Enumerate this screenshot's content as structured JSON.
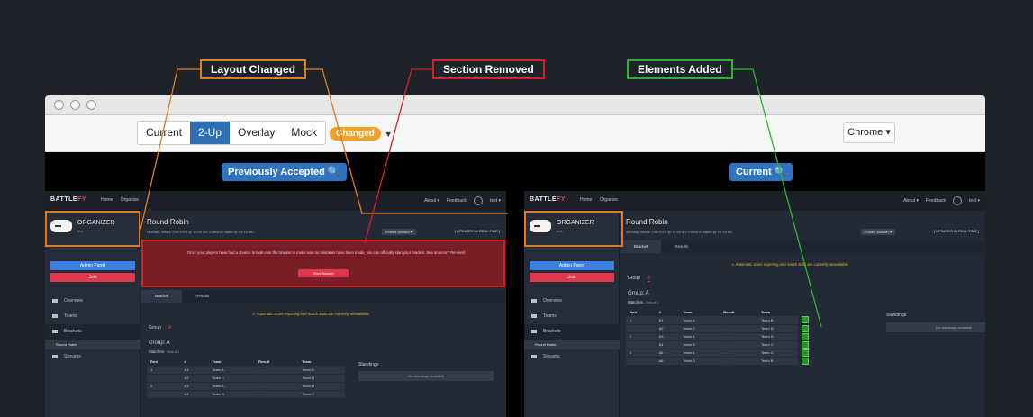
{
  "callouts": {
    "layout": "Layout Changed",
    "removed": "Section Removed",
    "added": "Elements Added"
  },
  "toolbar": {
    "modes": [
      "Current",
      "2-Up",
      "Overlay",
      "Mock"
    ],
    "active_mode": "2-Up",
    "status_badge": "Changed",
    "browser": "Chrome ▾"
  },
  "panes": {
    "left_label": "Previously Accepted 🔍",
    "right_label": "Current 🔍"
  },
  "app": {
    "logo_a": "BATTLE",
    "logo_b": "FY",
    "nav": [
      "Home",
      "Organize"
    ],
    "nav_right": [
      "About ▾",
      "Feedback",
      "test ▾"
    ],
    "org_name": "ORGANIZER",
    "org_sub": "test",
    "admin_btn": "Admin Panel",
    "join_btn": "Join",
    "menu": [
      "Overview",
      "Teams",
      "Brackets",
      "Streams"
    ],
    "menu_sub": "Round Robin",
    "title": "Round Robin",
    "meta": "Monday, March 2nd 2015 @ 11:00 am    Check-in starts @ 10:45 am",
    "embed": "Embed Bracket ▾",
    "realtime": "[ UPDATES IN REAL TIME ]",
    "alert_text": "Once your players have had a chance to look over the bracket to make sure no mistakes have been made, you can officially start your bracket. See an error? Re-seed",
    "alert_btn": "Start Bracket",
    "tabs": [
      "Bracket",
      "Results"
    ],
    "warning": "⚠ Automatic score reporting and match stats are currently unavailable",
    "group_label": "Group",
    "group_value": "A",
    "group_heading": "Group: A",
    "matches": "Matches",
    "matches_sub": "- Best of 1",
    "columns": [
      "Rnd",
      "#",
      "Team",
      "Result",
      "Team"
    ],
    "rows": [
      {
        "rnd": "1",
        "num": "A1",
        "t1": "Team A",
        "res": "- : -",
        "t2": "Team B"
      },
      {
        "rnd": "",
        "num": "A2",
        "t1": "Team C",
        "res": "- : -",
        "t2": "Team D"
      },
      {
        "rnd": "2",
        "num": "A3",
        "t1": "Team A",
        "res": "- : -",
        "t2": "Team D"
      },
      {
        "rnd": "",
        "num": "A4",
        "t1": "Team B",
        "res": "- : -",
        "t2": "Team C"
      },
      {
        "rnd": "3",
        "num": "A5",
        "t1": "Team A",
        "res": "- : -",
        "t2": "Team C"
      },
      {
        "rnd": "",
        "num": "A6",
        "t1": "Team D",
        "res": "- : -",
        "t2": "Team B"
      }
    ],
    "standings": "Standings",
    "no_standings": "No standings available"
  }
}
